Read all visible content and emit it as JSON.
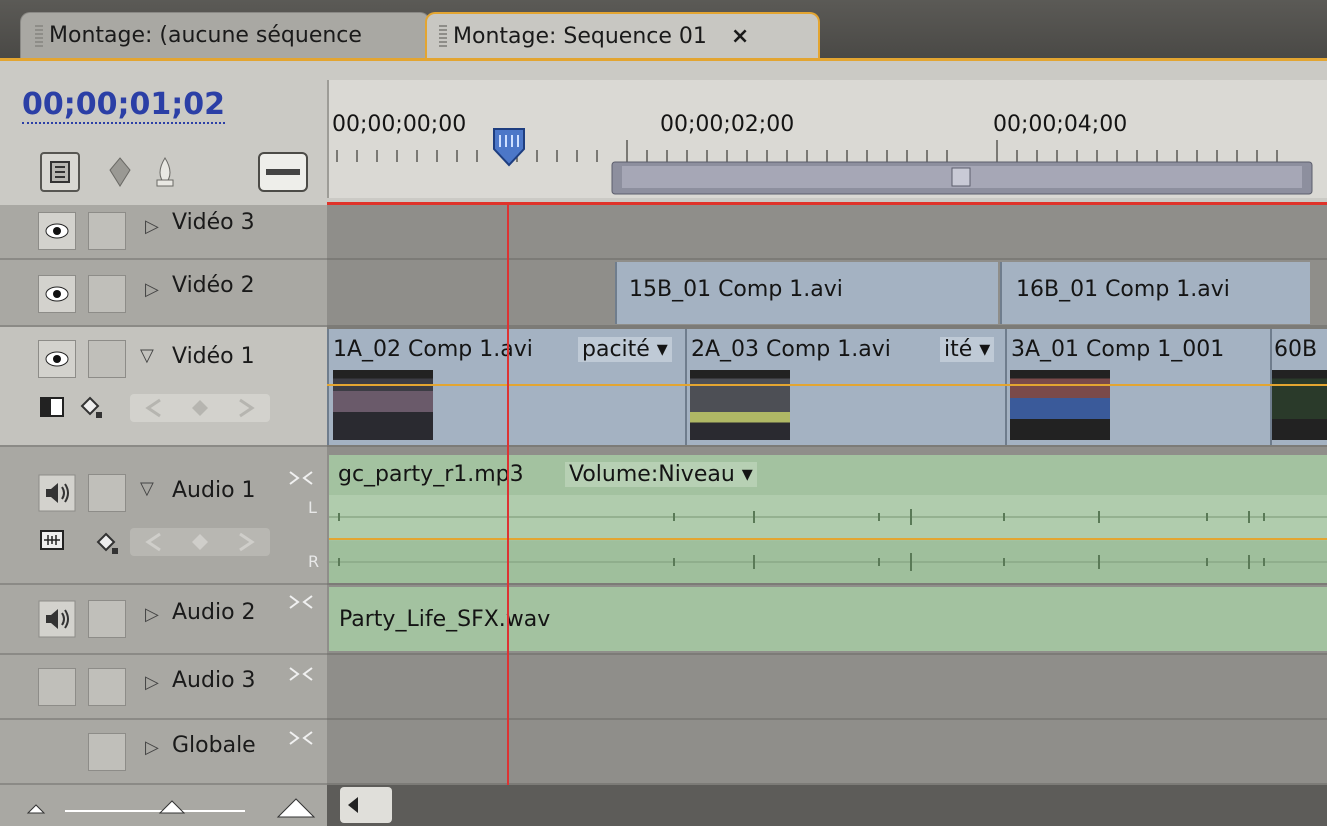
{
  "tabs": [
    {
      "label": "Montage: (aucune séquence",
      "active": false
    },
    {
      "label": "Montage: Sequence 01",
      "active": true,
      "close": "×"
    }
  ],
  "timecode": "00;00;01;02",
  "ruler_labels": [
    "00;00;00;00",
    "00;00;02;00",
    "00;00;04;00"
  ],
  "tracks": {
    "video3": {
      "name": "Vidéo 3"
    },
    "video2": {
      "name": "Vidéo 2"
    },
    "video1": {
      "name": "Vidéo 1"
    },
    "audio1": {
      "name": "Audio 1",
      "channel_l": "L",
      "channel_r": "R"
    },
    "audio2": {
      "name": "Audio 2"
    },
    "audio3": {
      "name": "Audio 3"
    },
    "globale": {
      "name": "Globale"
    }
  },
  "clips": {
    "v2": [
      "15B_01 Comp 1.avi",
      "16B_01 Comp 1.avi"
    ],
    "v1": [
      "1A_02 Comp 1.avi",
      "2A_03 Comp 1.avi",
      "3A_01 Comp 1_001",
      "60B"
    ],
    "v1_fx": [
      "pacité ▾",
      "ité ▾"
    ],
    "a1": "gc_party_r1.mp3",
    "a1_fx": "Volume:Niveau ▾",
    "a2": "Party_Life_SFX.wav"
  },
  "colors": {
    "accent": "#e3a531",
    "playhead": "#e0332a",
    "video_clip": "#a4b2c2",
    "audio_clip": "#a3c2a0",
    "timecode": "#2b3fa6"
  }
}
